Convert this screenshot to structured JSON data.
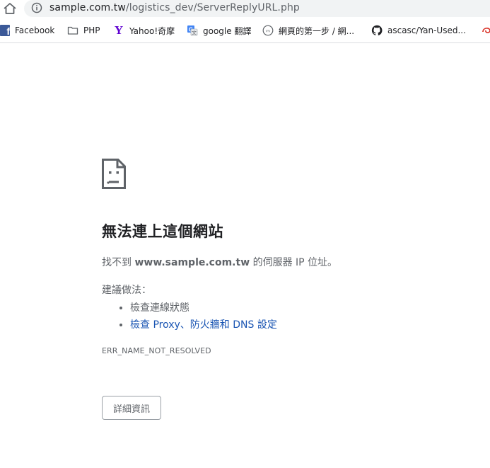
{
  "address_bar": {
    "url_host": "sample.com.tw",
    "url_path": "/logistics_dev/ServerReplyURL.php"
  },
  "bookmarks": [
    {
      "label": "Facebook",
      "icon": "facebook-icon",
      "color": "#3b5998"
    },
    {
      "label": "PHP",
      "icon": "folder-icon"
    },
    {
      "label": "Yahoo!奇摩",
      "icon": "yahoo-icon",
      "color": "#5f01d1"
    },
    {
      "label": "google 翻譯",
      "icon": "google-translate-icon",
      "color": "#4285f4"
    },
    {
      "label": "網頁的第一步 / 網...",
      "icon": "globe-icon"
    },
    {
      "label": "ascasc/Yan-Used...",
      "icon": "github-icon"
    }
  ],
  "error": {
    "title": "無法連上這個網站",
    "desc_before": "找不到 ",
    "desc_host": "www.sample.com.tw",
    "desc_after": " 的伺服器 IP 位址。",
    "suggestions_heading": "建議做法：",
    "suggestions": [
      {
        "text": "檢查連線狀態",
        "link": false
      },
      {
        "text": "檢查 Proxy、防火牆和 DNS 設定",
        "link": true
      }
    ],
    "code": "ERR_NAME_NOT_RESOLVED",
    "details_button": "詳細資訊"
  },
  "colors": {
    "link": "#1a55b3",
    "text_secondary": "#5f6368",
    "omnibox_bg": "#f1f3f4"
  }
}
